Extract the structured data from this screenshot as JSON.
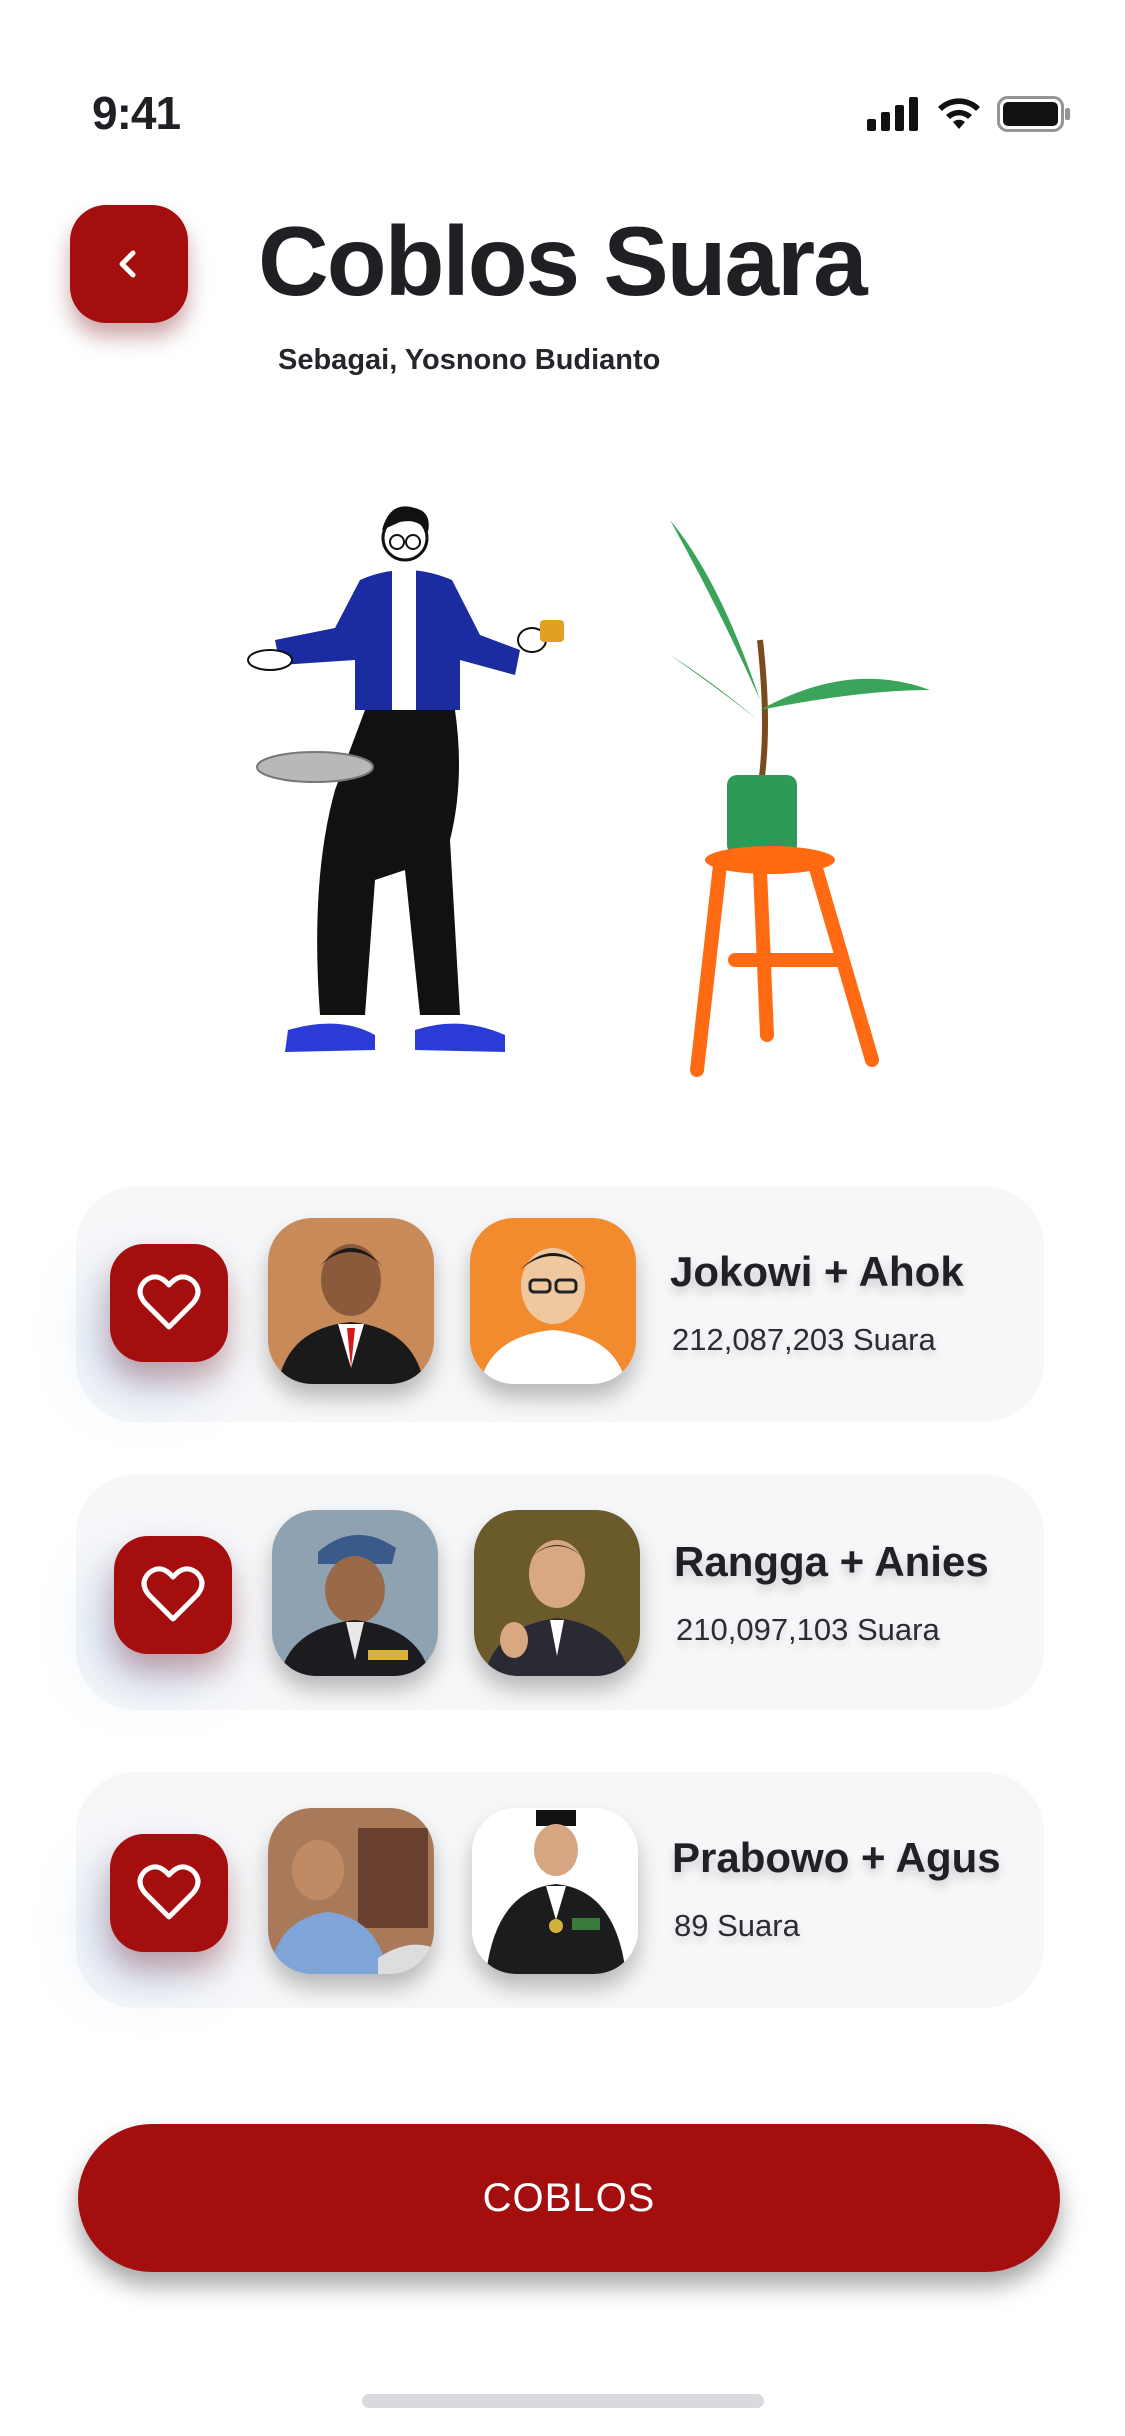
{
  "status_bar": {
    "time": "9:41"
  },
  "header": {
    "title": "Coblos Suara",
    "subtitle": "Sebagai, Yosnono Budianto",
    "back_icon": "chevron-left-icon"
  },
  "candidates": [
    {
      "name": "Jokowi + Ahok",
      "votes": "212,087,203 Suara"
    },
    {
      "name": "Rangga + Anies",
      "votes": "210,097,103 Suara"
    },
    {
      "name": "Prabowo + Agus",
      "votes": "89 Suara"
    }
  ],
  "action": {
    "label": "COBLOS"
  },
  "colors": {
    "accent": "#a50e0e",
    "card_bg": "#f6f7f9",
    "text": "#1f2024"
  }
}
